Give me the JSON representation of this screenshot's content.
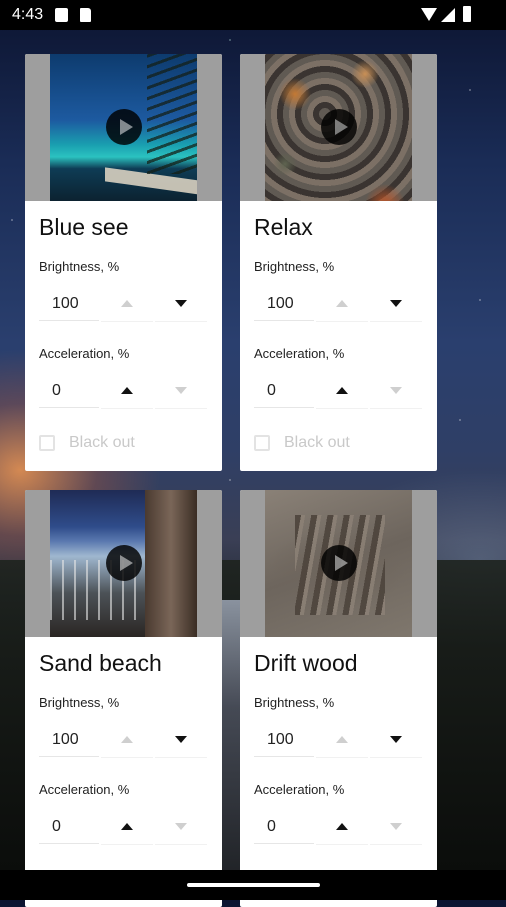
{
  "status_bar": {
    "time": "4:43"
  },
  "cards": [
    {
      "title": "Blue see",
      "brightness": {
        "label": "Brightness, %",
        "value": "100",
        "up_enabled": false,
        "down_enabled": true
      },
      "acceleration": {
        "label": "Acceleration, %",
        "value": "0",
        "up_enabled": true,
        "down_enabled": false
      },
      "blackout": {
        "label": "Black out",
        "checked": false,
        "enabled": false
      }
    },
    {
      "title": "Relax",
      "brightness": {
        "label": "Brightness, %",
        "value": "100",
        "up_enabled": false,
        "down_enabled": true
      },
      "acceleration": {
        "label": "Acceleration, %",
        "value": "0",
        "up_enabled": true,
        "down_enabled": false
      },
      "blackout": {
        "label": "Black out",
        "checked": false,
        "enabled": false
      }
    },
    {
      "title": "Sand beach",
      "brightness": {
        "label": "Brightness, %",
        "value": "100",
        "up_enabled": false,
        "down_enabled": true
      },
      "acceleration": {
        "label": "Acceleration, %",
        "value": "0",
        "up_enabled": true,
        "down_enabled": false
      }
    },
    {
      "title": "Drift wood",
      "brightness": {
        "label": "Brightness, %",
        "value": "100",
        "up_enabled": false,
        "down_enabled": true
      },
      "acceleration": {
        "label": "Acceleration, %",
        "value": "0",
        "up_enabled": true,
        "down_enabled": false
      }
    }
  ]
}
